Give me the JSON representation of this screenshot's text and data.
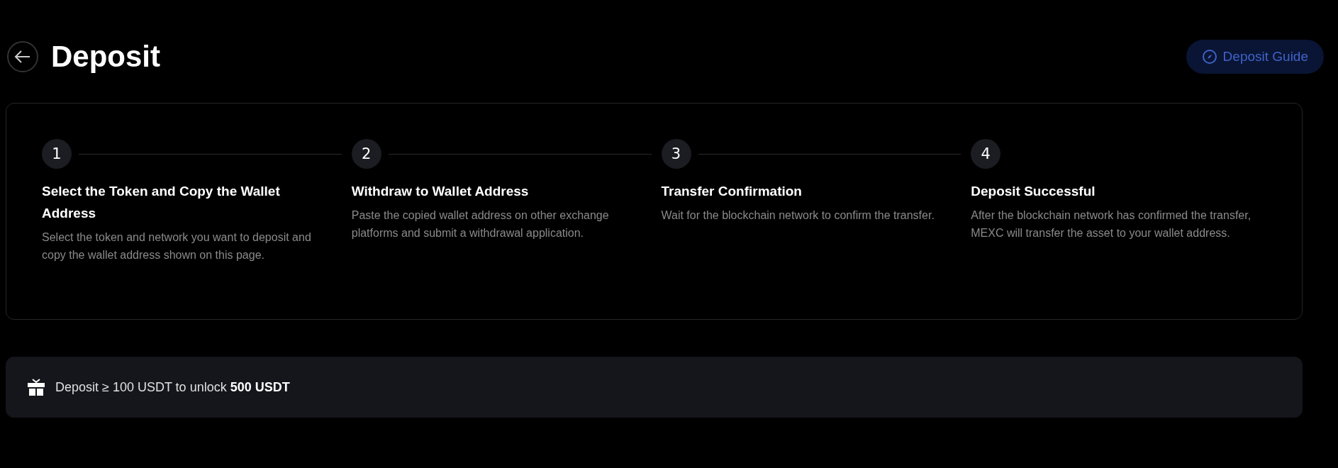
{
  "header": {
    "title": "Deposit",
    "guide_button": "Deposit Guide"
  },
  "steps": [
    {
      "number": "1",
      "title": "Select the Token and Copy the Wallet Address",
      "description": "Select the token and network you want to deposit and copy the wallet address shown on this page."
    },
    {
      "number": "2",
      "title": "Withdraw to Wallet Address",
      "description": "Paste the copied wallet address on other exchange platforms and submit a withdrawal application."
    },
    {
      "number": "3",
      "title": "Transfer Confirmation",
      "description": "Wait for the blockchain network to confirm the transfer."
    },
    {
      "number": "4",
      "title": "Deposit Successful",
      "description": "After the blockchain network has confirmed the transfer, MEXC will transfer the asset to your wallet address."
    }
  ],
  "promo": {
    "text": "Deposit ≥ 100 USDT to unlock **500 USDT**"
  }
}
